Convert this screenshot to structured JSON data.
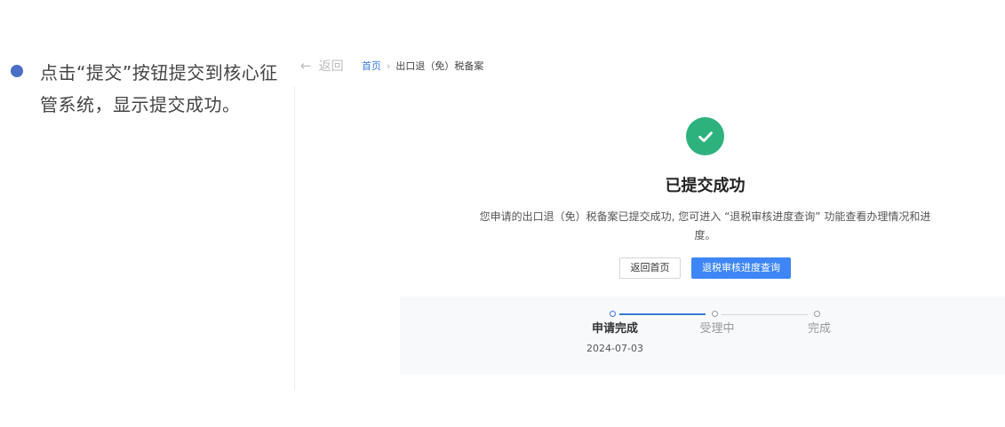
{
  "annotation": {
    "text": "点击“提交”按钮提交到核心征管系统，显示提交成功。"
  },
  "header": {
    "back_label": "返回",
    "breadcrumb": {
      "home": "首页",
      "separator": "›",
      "current": "出口退（免）税备案"
    }
  },
  "result": {
    "title": "已提交成功",
    "description": "您申请的出口退（免）税备案已提交成功, 您可进入 “退税审核进度查询” 功能查看办理情况和进度。",
    "buttons": {
      "home": "返回首页",
      "query": "退税审核进度查询"
    }
  },
  "progress": {
    "steps": [
      {
        "label": "申请完成",
        "date": "2024-07-03",
        "status": "done"
      },
      {
        "label": "受理中",
        "status": "pending"
      },
      {
        "label": "完成",
        "status": "pending"
      }
    ]
  },
  "colors": {
    "success": "#2db27d",
    "primary": "#3e86f5",
    "link": "#3a7bd5",
    "annotation_dot": "#4a6fc7"
  }
}
